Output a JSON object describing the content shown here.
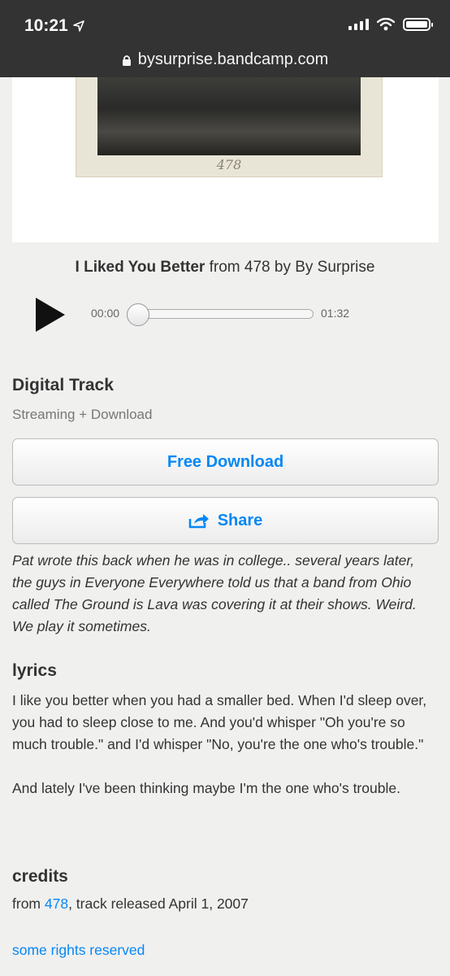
{
  "status": {
    "time": "10:21"
  },
  "browser": {
    "url": "bysurprise.bandcamp.com"
  },
  "album_art": {
    "caption": "478"
  },
  "track": {
    "name": "I Liked You Better",
    "from_word": "from",
    "album": "478",
    "by_word": "by",
    "artist": "By Surprise"
  },
  "player": {
    "current_time": "00:00",
    "duration": "01:32",
    "progress": 0
  },
  "purchase": {
    "heading": "Digital Track",
    "subheading": "Streaming + Download",
    "download_label": "Free Download",
    "share_label": "Share"
  },
  "about": {
    "text": "Pat wrote this back when he was in college.. several years later, the guys in Everyone Everywhere told us that a band from Ohio called The Ground is Lava was covering it at their shows. Weird. We play it sometimes."
  },
  "lyrics": {
    "heading": "lyrics",
    "paragraphs": [
      "I like you better when you had a smaller bed. When I'd sleep over, you had to sleep close to me. And you'd whisper \"Oh you're so much trouble.\" and I'd whisper \"No, you're the one who's trouble.\"",
      "And lately I've been thinking maybe I'm the one who's trouble."
    ]
  },
  "credits": {
    "heading": "credits",
    "prefix": "from",
    "album_link": "478",
    "suffix": ", track released April 1, 2007",
    "rights_link": "some rights reserved"
  },
  "colors": {
    "accent": "#0687f5",
    "background": "#f0f0ef",
    "topbar": "#333333"
  }
}
